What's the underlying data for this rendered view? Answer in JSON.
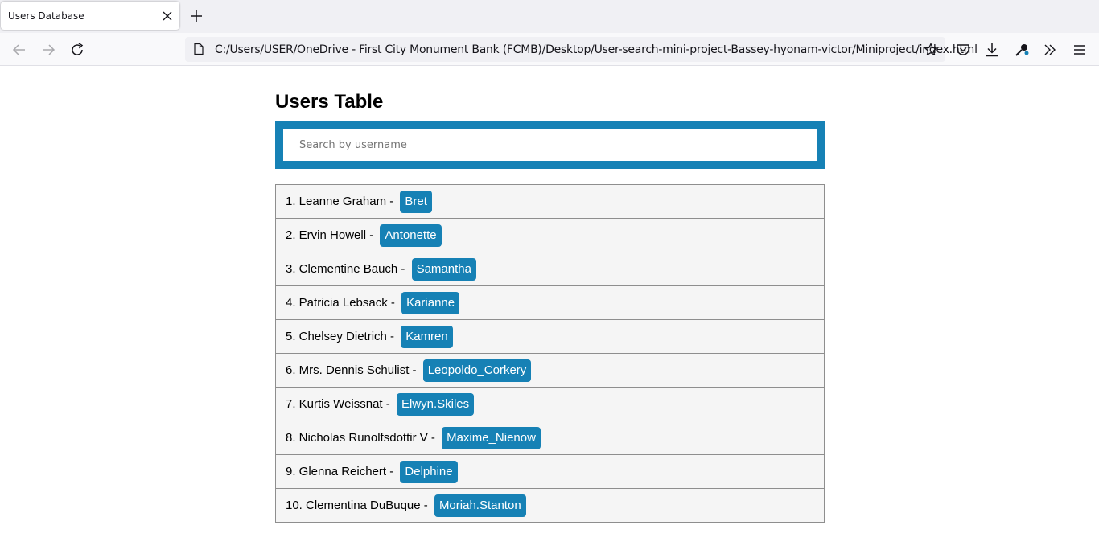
{
  "browser": {
    "tab_title": "Users Database",
    "url": "C:/Users/USER/OneDrive - First City Monument Bank (FCMB)/Desktop/User-search-mini-project-Bassey-hyonam-victor/Miniproject/index.html",
    "icons": {
      "tab_close": "close-icon",
      "new_tab": "plus-icon",
      "back": "arrow-left-icon",
      "forward": "arrow-right-icon",
      "reload": "reload-icon",
      "page": "page-icon",
      "bookmark": "star-icon",
      "pocket": "pocket-icon",
      "downloads": "download-icon",
      "extension": "extension-icon",
      "overflow": "chevrons-right-icon",
      "menu": "hamburger-menu-icon"
    }
  },
  "page": {
    "title": "Users Table",
    "search": {
      "placeholder": "Search by username",
      "value": ""
    },
    "users": [
      {
        "label": "1. Leanne Graham - ",
        "username": "Bret"
      },
      {
        "label": "2. Ervin Howell - ",
        "username": "Antonette"
      },
      {
        "label": "3. Clementine Bauch - ",
        "username": "Samantha"
      },
      {
        "label": "4. Patricia Lebsack - ",
        "username": "Karianne"
      },
      {
        "label": "5. Chelsey Dietrich - ",
        "username": "Kamren"
      },
      {
        "label": "6. Mrs. Dennis Schulist - ",
        "username": "Leopoldo_Corkery"
      },
      {
        "label": "7. Kurtis Weissnat - ",
        "username": "Elwyn.Skiles"
      },
      {
        "label": "8. Nicholas Runolfsdottir V - ",
        "username": "Maxime_Nienow"
      },
      {
        "label": "9. Glenna Reichert - ",
        "username": "Delphine"
      },
      {
        "label": "10. Clementina DuBuque - ",
        "username": "Moriah.Stanton"
      }
    ]
  },
  "colors": {
    "accent": "#1681b5",
    "row_background": "#f5f5f5",
    "row_border": "#8e8e8e"
  }
}
